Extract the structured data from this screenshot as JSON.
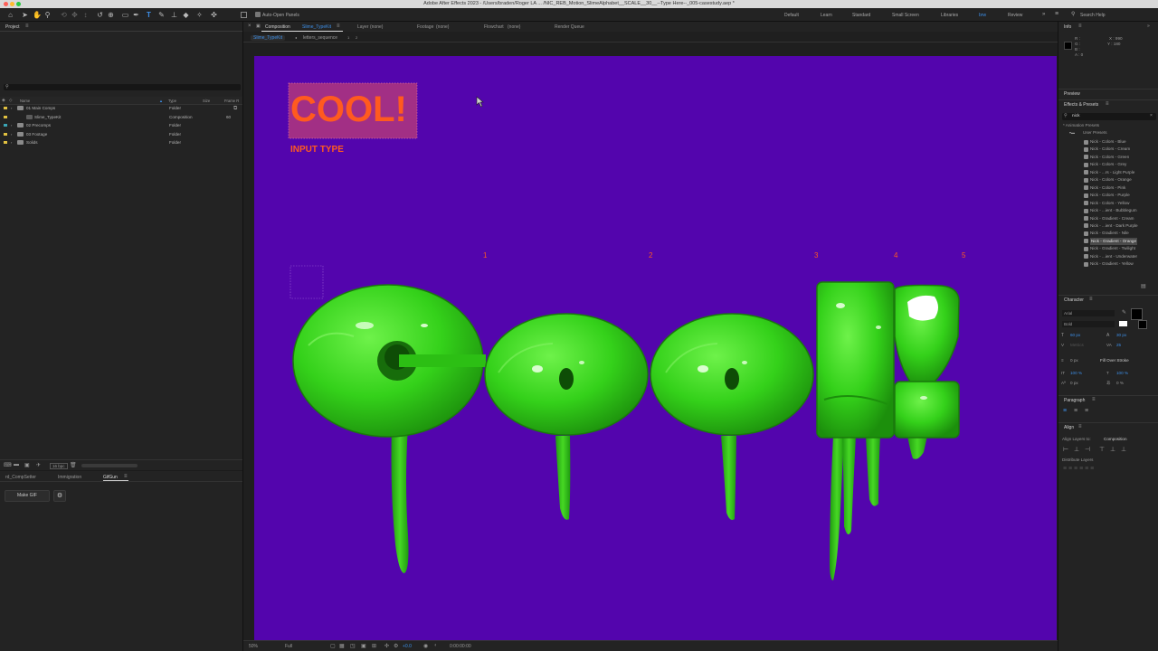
{
  "window": {
    "title": "Adobe After Effects 2023 - /Users/braden/Roger LA ... /NIC_REB_Motion_SlimeAlphabet__SCALE__30__--Type Here--_005-casestudy.aep *"
  },
  "toolbar": {
    "auto_open_panels": "Auto-Open Panels",
    "workspaces": [
      "Default",
      "Learn",
      "Standard",
      "Small Screen",
      "Libraries",
      "brw",
      "Review"
    ],
    "active_workspace": "brw",
    "search_help": "Search Help"
  },
  "project": {
    "title": "Project",
    "columns": [
      "Name",
      "Type",
      "Size",
      "Frame R"
    ],
    "items": [
      {
        "name": "01 Main Comps",
        "type": "Folder",
        "size": "",
        "frame": "",
        "swatch": "#e0c040",
        "indent": 0,
        "kind": "folder"
      },
      {
        "name": "Slime_TypeKit",
        "type": "Composition",
        "size": "",
        "frame": "60",
        "swatch": "#e0c040",
        "indent": 1,
        "kind": "comp"
      },
      {
        "name": "02 Precomps",
        "type": "Folder",
        "size": "",
        "frame": "",
        "swatch": "#3aa5b5",
        "indent": 0,
        "kind": "folder"
      },
      {
        "name": "03 Footage",
        "type": "Folder",
        "size": "",
        "frame": "",
        "swatch": "#e0c040",
        "indent": 0,
        "kind": "folder"
      },
      {
        "name": "Solids",
        "type": "Folder",
        "size": "",
        "frame": "",
        "swatch": "#e0c040",
        "indent": 0,
        "kind": "folder"
      }
    ],
    "bpc": "16 bpc"
  },
  "bottom_left": {
    "tabs": [
      "rd_CompSetter",
      "Immigration",
      "GifGun"
    ],
    "active_tab": "GifGun",
    "make_gif": "Make GIF"
  },
  "viewer": {
    "tabs": [
      {
        "label": "Composition",
        "value": "Slime_TypeKit"
      },
      {
        "label": "Layer",
        "value": "(none)"
      },
      {
        "label": "Footage",
        "value": "(none)"
      },
      {
        "label": "Flowchart",
        "value": "(none)"
      },
      {
        "label": "Render Queue",
        "value": ""
      }
    ],
    "breadcrumbs": [
      "Slime_TypeKit",
      "letters_sequence"
    ],
    "bg_color": "#5305ad",
    "input_text": "COOL!",
    "input_label": "INPUT TYPE",
    "slime_letters": "Cool!",
    "markers": [
      "1",
      "2",
      "3",
      "4",
      "5"
    ],
    "zoom": "50%",
    "quality": "Full",
    "exposure": "+0.0",
    "timecode": "0:00:00:00"
  },
  "info": {
    "title": "Info",
    "r": "R :",
    "g": "G :",
    "b": "B :",
    "a": "A : 0",
    "x": "X : 990",
    "y": "Y : 180"
  },
  "preview": {
    "title": "Preview"
  },
  "effects": {
    "title": "Effects & Presets",
    "search": "nick",
    "root": "* Animation Presets",
    "folder": "User Presets",
    "presets": [
      "Nick - Colors - Blue",
      "Nick - Colors - Cream",
      "Nick - Colors - Green",
      "Nick - Colors - Grey",
      "Nick - ...rs - Light Purple",
      "Nick - Colors - Orange",
      "Nick - Colors - Pink",
      "Nick - Colors - Purple",
      "Nick - Colors - Yellow",
      "Nick - ...ient - Bubblegum",
      "Nick - Gradient - Cream",
      "Nick - ...ient - Dark Purple",
      "Nick - Gradient - Nile",
      "Nick - Gradient - Orange",
      "Nick - Gradient - Twilight",
      "Nick - ...ient - Underwater",
      "Nick - Gradient - Yellow"
    ],
    "selected_index": 13
  },
  "character": {
    "title": "Character",
    "font": "Arial",
    "style": "Bold",
    "size": "60 px",
    "leading": "30 px",
    "kerning": "Metrics",
    "tracking": "25",
    "stroke": "0 px",
    "stroke_mode": "Fill Over Stroke",
    "vscale": "100 %",
    "hscale": "100 %",
    "baseline": "0 px",
    "tsume": "0 %"
  },
  "paragraph": {
    "title": "Paragraph"
  },
  "align": {
    "title": "Align",
    "align_to_label": "Align Layers to:",
    "align_to_value": "Composition",
    "distribute": "Distribute Layers"
  },
  "colors": {
    "accent": "#3d8fe8",
    "slime": "#39d81c",
    "input_text": "#ff5a1f",
    "input_box": "#b0377e"
  }
}
